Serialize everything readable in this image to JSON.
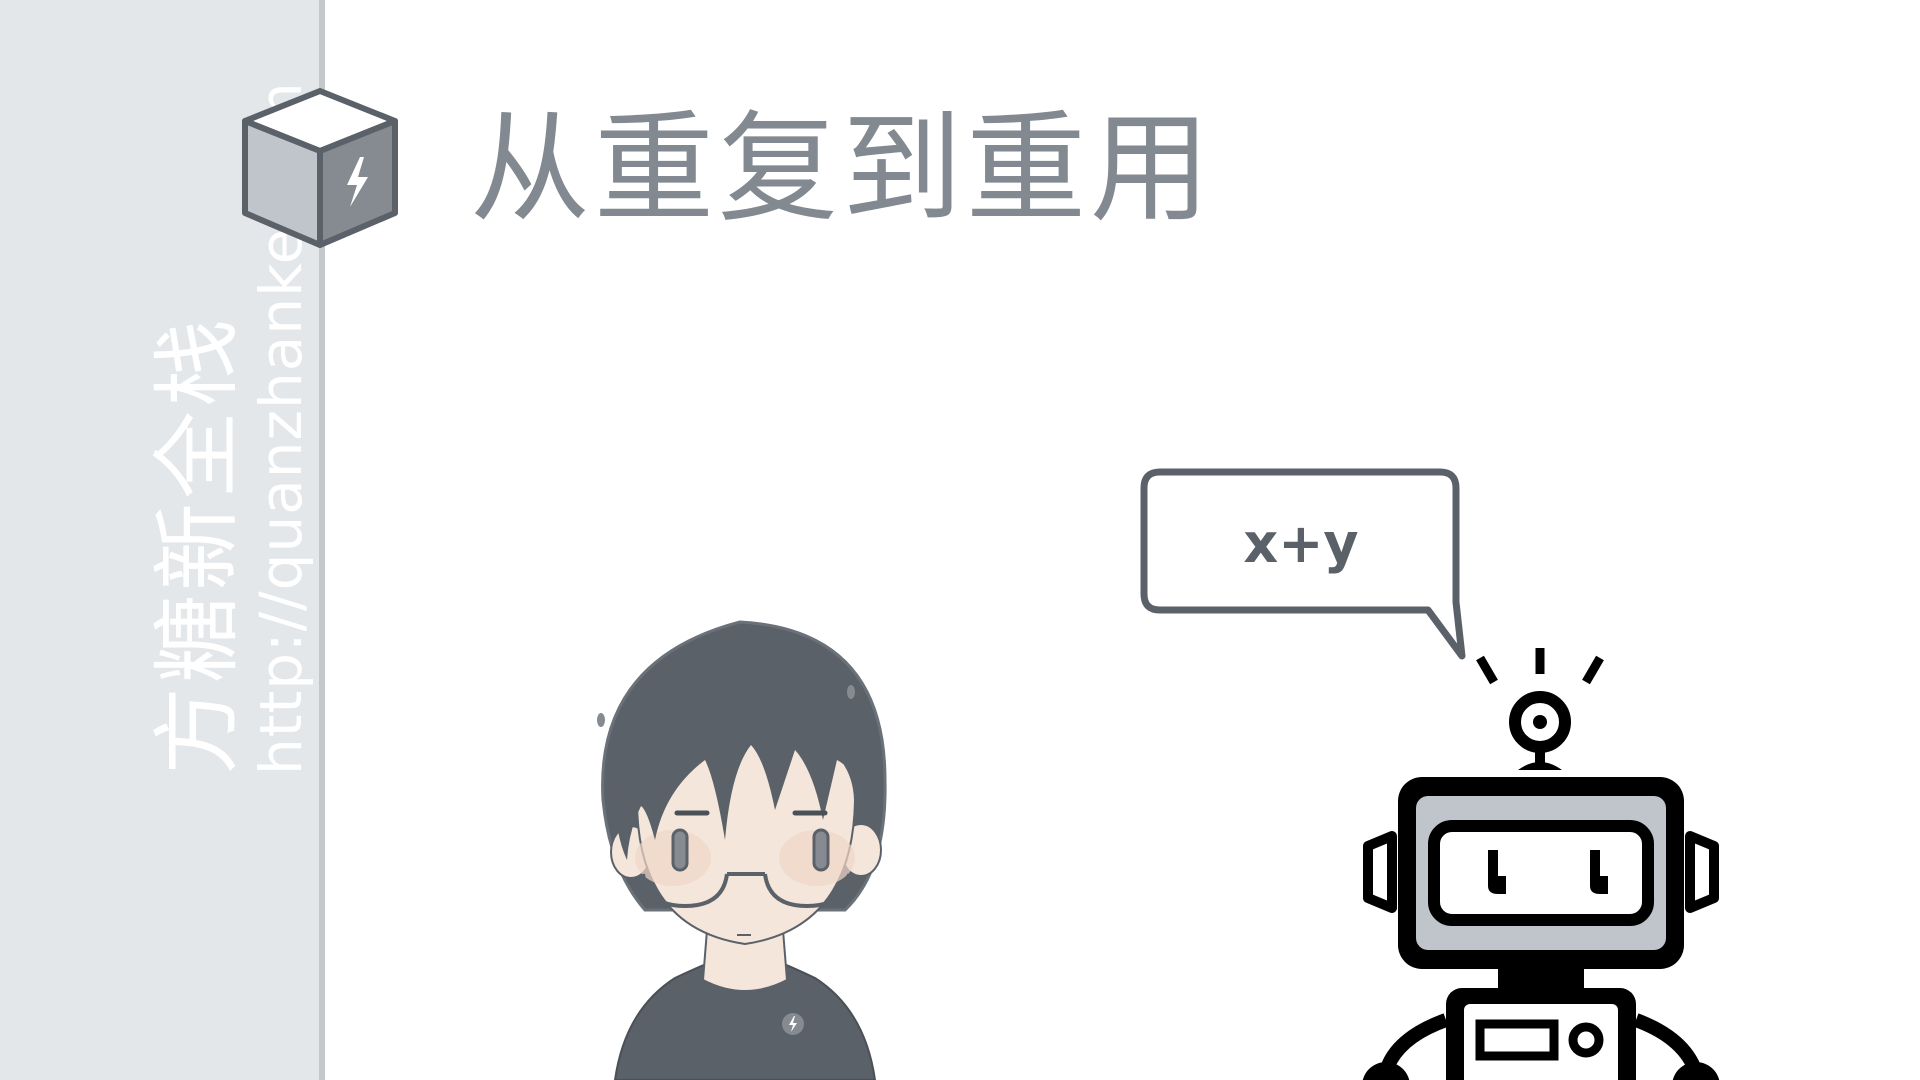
{
  "slide": {
    "title": "从重复到重用"
  },
  "brand": {
    "name": "方糖新全栈",
    "url": "http://quanzhanke.com"
  },
  "speech_bubble": {
    "text": "x+y"
  },
  "colors": {
    "sidebar_bg": "#e4e7ea",
    "sidebar_border": "#c3c8cd",
    "title_text": "#828990",
    "icon_dark": "#5b6168",
    "bubble_text": "#5b6168"
  },
  "icons": {
    "logo": "sugar-cube-lightning-icon",
    "person": "programmer-avatar",
    "robot": "robot"
  }
}
